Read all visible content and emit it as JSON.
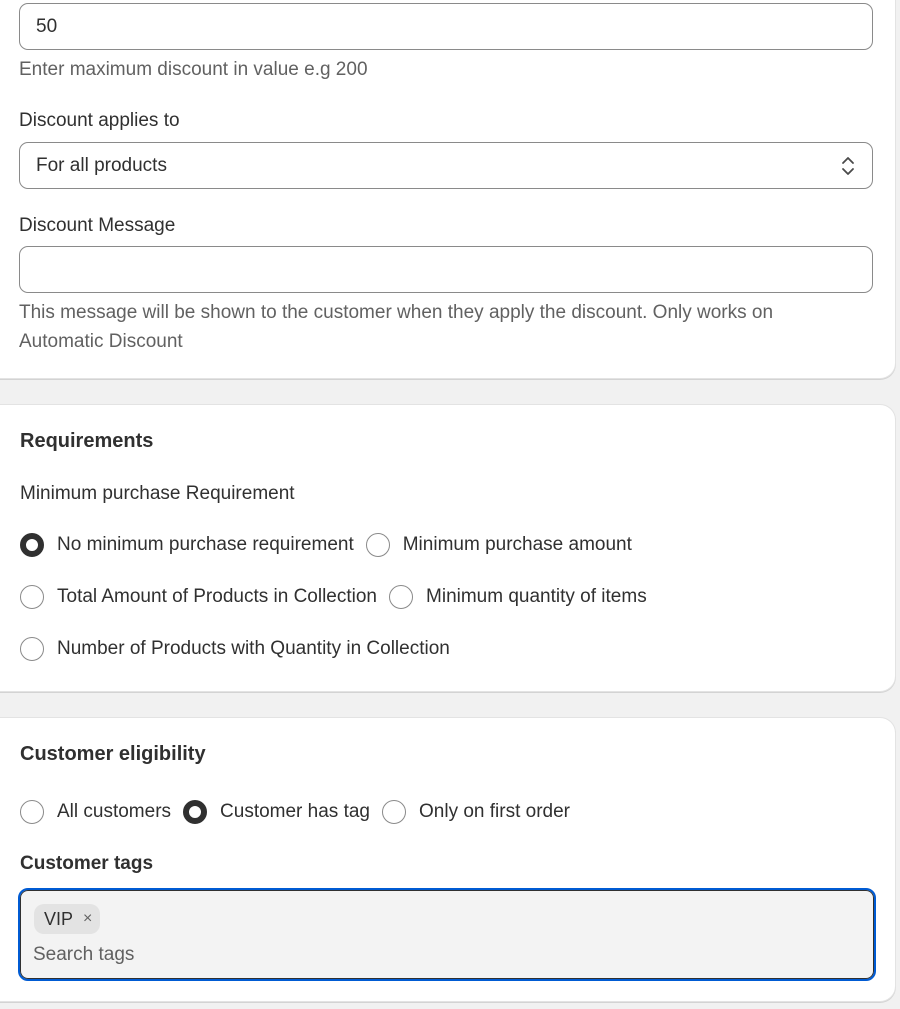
{
  "discount": {
    "max_value": "50",
    "max_help": "Enter maximum discount in value e.g 200",
    "applies_label": "Discount applies to",
    "applies_value": "For all products",
    "message_label": "Discount Message",
    "message_value": "",
    "message_help_line1": "This message will be shown to the customer when they apply the discount. Only works on",
    "message_help_line2": "Automatic Discount"
  },
  "requirements": {
    "title": "Requirements",
    "subtitle": "Minimum purchase Requirement",
    "options": [
      {
        "label": "No minimum purchase requirement",
        "checked": true
      },
      {
        "label": "Minimum purchase amount",
        "checked": false
      },
      {
        "label": "Total Amount of Products in Collection",
        "checked": false
      },
      {
        "label": "Minimum quantity of items",
        "checked": false
      },
      {
        "label": "Number of Products with Quantity in Collection",
        "checked": false
      }
    ]
  },
  "eligibility": {
    "title": "Customer eligibility",
    "options": [
      {
        "label": "All customers",
        "checked": false
      },
      {
        "label": "Customer has tag",
        "checked": true
      },
      {
        "label": "Only on first order",
        "checked": false
      }
    ],
    "tags_label": "Customer tags",
    "tags": [
      {
        "label": "VIP"
      }
    ],
    "tag_remove_glyph": "×",
    "search_placeholder": "Search tags"
  },
  "colors": {
    "focus_ring": "#005bd3",
    "radio_checked": "#303030",
    "background": "#f1f1f1"
  }
}
